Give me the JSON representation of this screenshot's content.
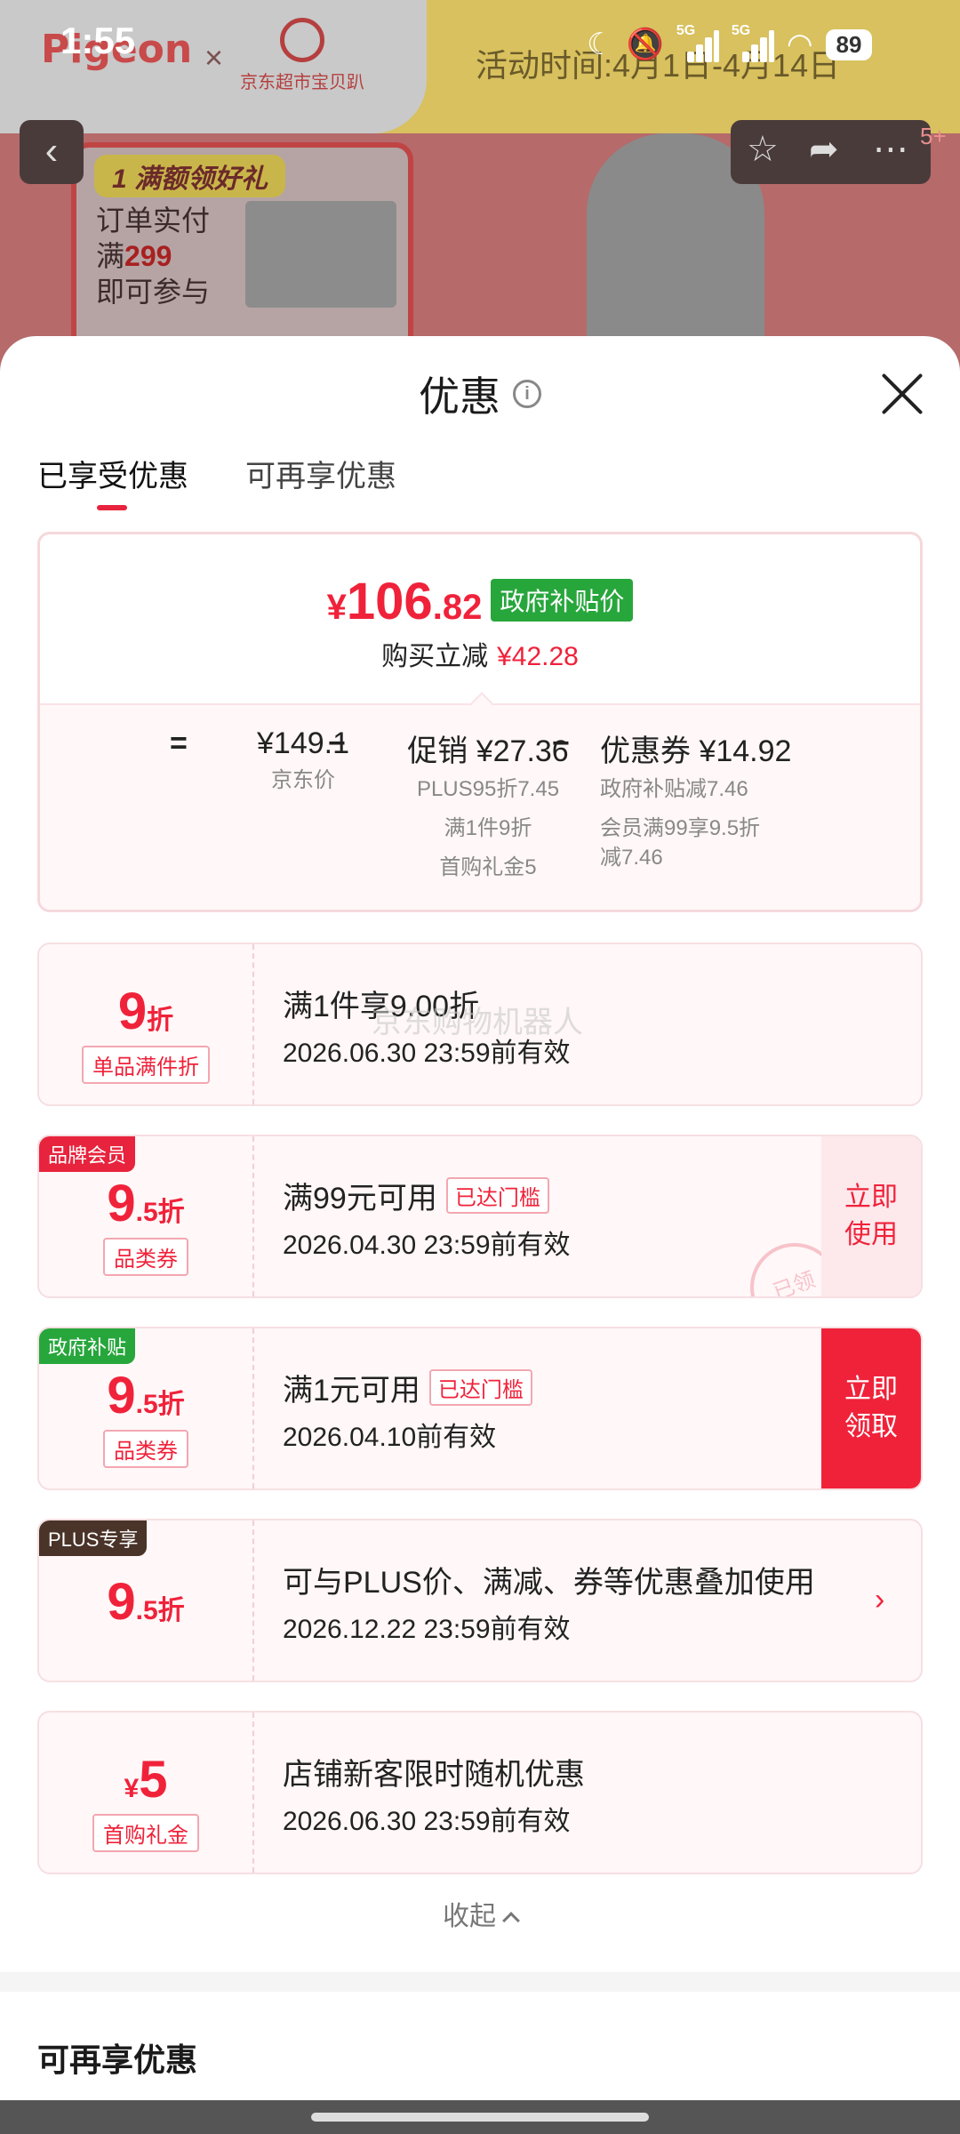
{
  "status_bar": {
    "time": "1:55",
    "battery": "89",
    "net1": "5G",
    "net2": "5G"
  },
  "background_page": {
    "brand_logo": "Pigeon",
    "brand_x": "×",
    "partner": "京东超市宝贝趴",
    "activity_time": "活动时间:4月1日-4月14日",
    "promo_tag": "1 满额领好礼",
    "promo_line1": "订单实付",
    "promo_line2_prefix": "满",
    "promo_line2_amount": "299",
    "promo_line3": "即可参与",
    "badge": "5+"
  },
  "sheet": {
    "title": "优惠",
    "tabs": [
      {
        "label": "已享受优惠",
        "active": true
      },
      {
        "label": "可再享优惠",
        "active": false
      }
    ],
    "summary": {
      "currency": "¥",
      "price_int": "106",
      "price_dec": ".82",
      "price_tag": "政府补贴价",
      "reduce_label": "购买立减",
      "reduce_amount": "¥42.28",
      "eq": "=",
      "minus": "−",
      "jd_price": "¥149.1",
      "jd_price_label": "京东价",
      "promo_head": "促销 ¥27.36",
      "promo_items": [
        "PLUS95折7.45",
        "满1件9折",
        "首购礼金5"
      ],
      "coupon_head": "优惠券 ¥14.92",
      "coupon_items": [
        "政府补贴减7.46",
        "会员满99享9.5折",
        "减7.46"
      ]
    },
    "coupons": [
      {
        "value_big": "9",
        "value_small": "折",
        "kind": "单品满件折",
        "condition": "满1件享9.00折",
        "expiry": "2026.06.30 23:59前有效",
        "watermark": "京东购物机器人"
      },
      {
        "corner": "品牌会员",
        "value_big": "9",
        "value_small": ".5折",
        "kind": "品类券",
        "condition": "满99元可用",
        "threshold": "已达门槛",
        "expiry": "2026.04.30 23:59前有效",
        "action": "立即使用",
        "stamp": "已领"
      },
      {
        "corner": "政府补贴",
        "value_big": "9",
        "value_small": ".5折",
        "kind": "品类券",
        "condition": "满1元可用",
        "threshold": "已达门槛",
        "expiry": "2026.04.10前有效",
        "action": "立即领取"
      },
      {
        "corner": "PLUS专享",
        "value_big": "9",
        "value_small": ".5折",
        "condition": "可与PLUS价、满减、券等优惠叠加使用",
        "expiry": "2026.12.22 23:59前有效"
      },
      {
        "currency": "¥",
        "value_big": "5",
        "kind": "首购礼金",
        "condition": "店铺新客限时随机优惠",
        "expiry": "2026.06.30 23:59前有效"
      }
    ],
    "collapse_label": "收起",
    "section2_title": "可再享优惠"
  },
  "colors": {
    "accent_red": "#f0223a",
    "gov_green": "#27a63c",
    "corner_red": "#e8233d",
    "corner_green": "#27a63c",
    "corner_plus": "#4a3328"
  }
}
